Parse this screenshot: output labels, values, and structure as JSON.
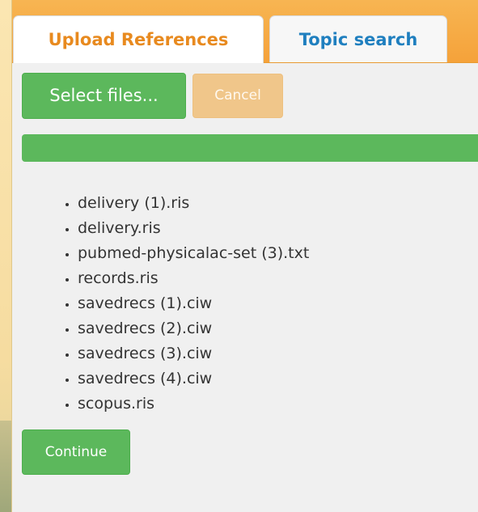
{
  "tabs": [
    {
      "label": "Upload References",
      "active": true
    },
    {
      "label": "Topic search",
      "active": false
    }
  ],
  "buttons": {
    "select_files": "Select files...",
    "cancel": "Cancel",
    "continue": "Continue"
  },
  "progress": {
    "value_percent": 100
  },
  "files": [
    "delivery (1).ris",
    "delivery.ris",
    "pubmed-physicalac-set (3).txt",
    "records.ris",
    "savedrecs (1).ciw",
    "savedrecs (2).ciw",
    "savedrecs (3).ciw",
    "savedrecs (4).ciw",
    "scopus.ris"
  ],
  "colors": {
    "primary_green": "#5cb85c",
    "tab_bar_orange": "#f5a23a",
    "active_tab_text": "#e88a1f",
    "inactive_tab_text": "#1f7fbf",
    "cancel_disabled": "#f0c68a"
  }
}
